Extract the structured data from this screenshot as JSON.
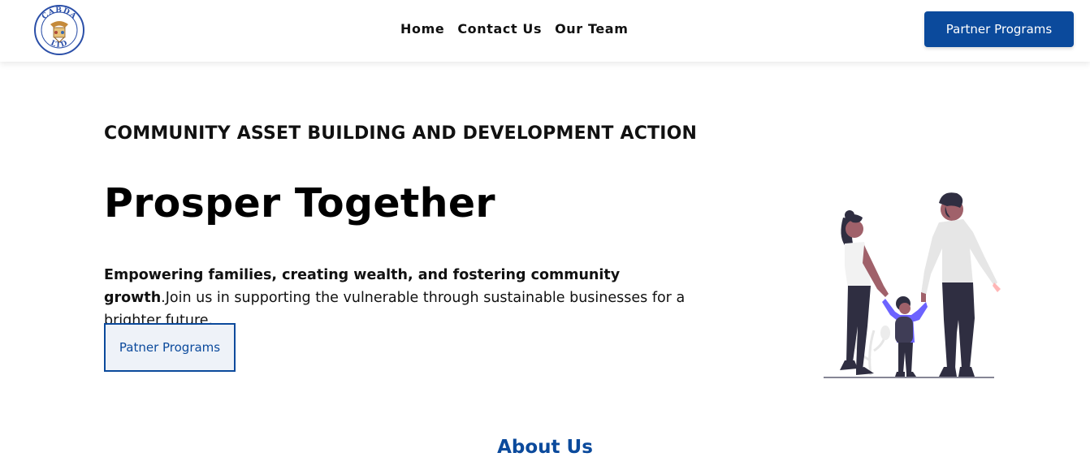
{
  "nav": {
    "logo_text_top": "CABDA",
    "logo_text_bottom": "LTD",
    "links": [
      "Home",
      "Contact Us",
      "Our Team"
    ],
    "cta_label": "Partner Programs"
  },
  "hero": {
    "eyebrow": "COMMUNITY ASSET BUILDING AND DEVELOPMENT ACTION",
    "title": "Prosper Together",
    "intro_bold": "Empowering families, creating wealth, and fostering community growth",
    "intro_rest": ".Join us in supporting the vulnerable through sustainable businesses for a brighter future.",
    "button_label": "Patner Programs"
  },
  "about": {
    "title": "About Us"
  },
  "colors": {
    "brand": "#0b4a9c",
    "accent_purple": "#6c63ff",
    "figure_dark": "#2f2e41",
    "skin": "#a0616a"
  }
}
